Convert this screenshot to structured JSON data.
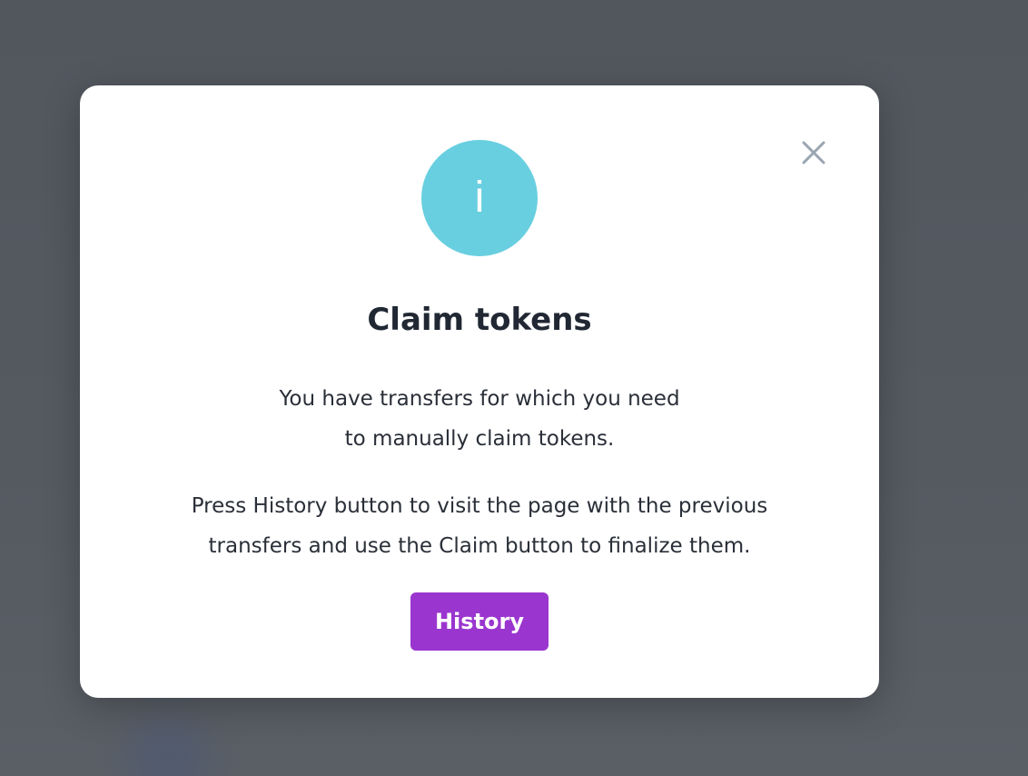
{
  "modal": {
    "title": "Claim tokens",
    "info_glyph": "i",
    "info_icon": "info-icon",
    "close_icon": "close-icon",
    "paragraph1": [
      "You have transfers for which you need",
      "to manually claim tokens."
    ],
    "paragraph2": [
      "Press History button to visit the page with the previous",
      "transfers and use the Claim button to finalize them."
    ],
    "history_button": "History"
  },
  "colors": {
    "overlay": "#535860",
    "info_circle": "#68cfe0",
    "button": "#9a36cf",
    "close_icon": "#9aa5b1",
    "title_text": "#212833"
  }
}
